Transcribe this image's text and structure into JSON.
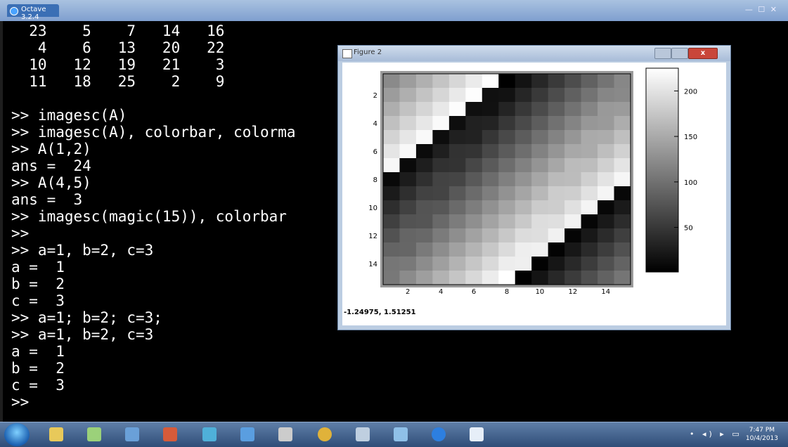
{
  "window": {
    "title": "Octave 3.2.4",
    "controls": "— ☐ ✕"
  },
  "console": {
    "lines": [
      "  23    5    7   14   16",
      "   4    6   13   20   22",
      "  10   12   19   21    3",
      "  11   18   25    2    9",
      "",
      ">> imagesc(A)",
      ">> imagesc(A), colorbar, colorma",
      ">> A(1,2)",
      "ans =  24",
      ">> A(4,5)",
      "ans =  3",
      ">> imagesc(magic(15)), colorbar",
      ">>",
      ">> a=1, b=2, c=3",
      "a =  1",
      "b =  2",
      "c =  3",
      ">> a=1; b=2; c=3;",
      ">> a=1, b=2, c=3",
      "a =  1",
      "b =  2",
      "c =  3",
      ">>"
    ]
  },
  "figure": {
    "title": "Figure 2",
    "close_label": "x",
    "coord_readout": "-1.24975, 1.51251",
    "x_ticks": [
      "2",
      "4",
      "6",
      "8",
      "10",
      "12",
      "14"
    ],
    "y_ticks": [
      "2",
      "4",
      "6",
      "8",
      "10",
      "12",
      "14"
    ],
    "colorbar_ticks": [
      "200",
      "150",
      "100",
      "50"
    ],
    "colorbar_values": [
      200,
      150,
      100,
      50
    ],
    "colorbar_range": [
      1,
      225
    ],
    "matrix_size": 15,
    "colormap": "gray"
  },
  "taskbar": {
    "apps": [
      {
        "name": "explorer-icon",
        "color": "#e8c95a"
      },
      {
        "name": "notes-icon",
        "color": "#9bd17a"
      },
      {
        "name": "paint-icon",
        "color": "#6aa0d8"
      },
      {
        "name": "powerpoint-icon",
        "color": "#d65b3a"
      },
      {
        "name": "network-icon",
        "color": "#4fb0d9"
      },
      {
        "name": "users-icon",
        "color": "#5a9ee0"
      },
      {
        "name": "printer-icon",
        "color": "#cccccc"
      },
      {
        "name": "chrome-icon",
        "color": "#e0b23a"
      },
      {
        "name": "media-icon",
        "color": "#bfcfe0"
      },
      {
        "name": "paint2-icon",
        "color": "#8fc0e8"
      },
      {
        "name": "octave-icon",
        "color": "#2d7fe0"
      },
      {
        "name": "figure-icon",
        "color": "#e6eef8"
      }
    ],
    "time": "7:47 PM",
    "date": "10/4/2013"
  }
}
